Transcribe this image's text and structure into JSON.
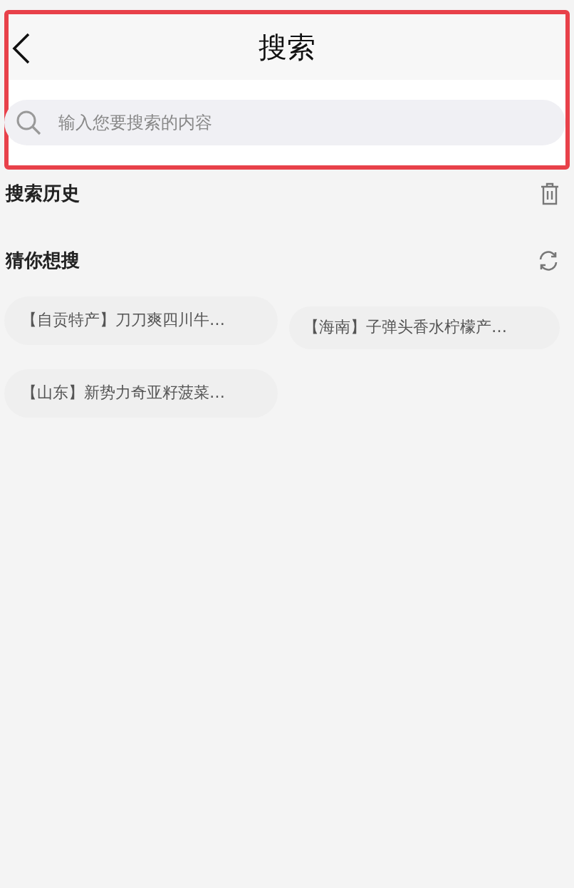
{
  "header": {
    "title": "搜索"
  },
  "search": {
    "placeholder": "输入您要搜索的内容"
  },
  "history": {
    "title": "搜索历史"
  },
  "suggestions": {
    "title": "猜你想搜",
    "items": [
      "【自贡特产】刀刀爽四川牛…",
      "【海南】子弹头香水柠檬产…",
      "【山东】新势力奇亚籽菠菜…"
    ]
  }
}
